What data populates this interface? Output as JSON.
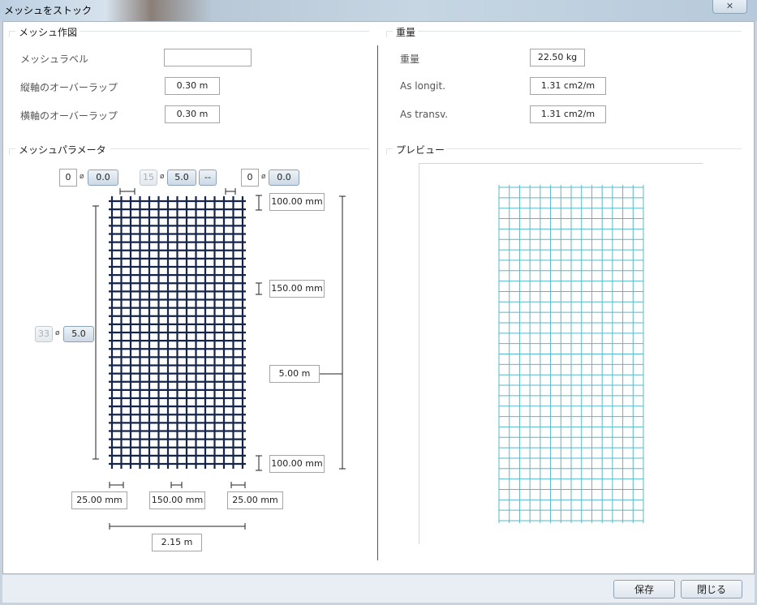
{
  "window": {
    "title": "メッシュをストック",
    "close_glyph": "✕"
  },
  "drawing": {
    "title": "メッシュ作図",
    "rows": [
      {
        "label": "メッシュラベル",
        "value": ""
      },
      {
        "label": "縦軸のオーバーラップ",
        "value": "0.30 m"
      },
      {
        "label": "横軸のオーバーラップ",
        "value": "0.30 m"
      }
    ]
  },
  "weight": {
    "title": "重量",
    "rows": [
      {
        "label": "重量",
        "value": "22.50 kg"
      },
      {
        "label": "As longit.",
        "value": "1.31 cm2/m"
      },
      {
        "label": "As transv.",
        "value": "1.31 cm2/m"
      }
    ]
  },
  "params": {
    "title": "メッシュパラメータ",
    "phi_glyph": "ø",
    "top": {
      "left_count": "0",
      "left_dia": "0.0",
      "mid_count": "15",
      "mid_dia": "5.0",
      "mid_extra": "--",
      "right_count": "0",
      "right_dia": "0.0"
    },
    "side": {
      "count": "33",
      "dia": "5.0"
    },
    "right_dims": {
      "top": "100.00 mm",
      "spacing": "150.00 mm",
      "length": "5.00 m",
      "bottom": "100.00 mm"
    },
    "bottom_dims": {
      "left": "25.00 mm",
      "spacing": "150.00 mm",
      "right": "25.00 mm",
      "width": "2.15 m"
    }
  },
  "preview": {
    "title": "プレビュー"
  },
  "footer": {
    "save": "保存",
    "close": "閉じる"
  },
  "colors": {
    "mesh": "#15244a",
    "preview_grid": "#56b9c9",
    "dim_line": "#222222"
  }
}
